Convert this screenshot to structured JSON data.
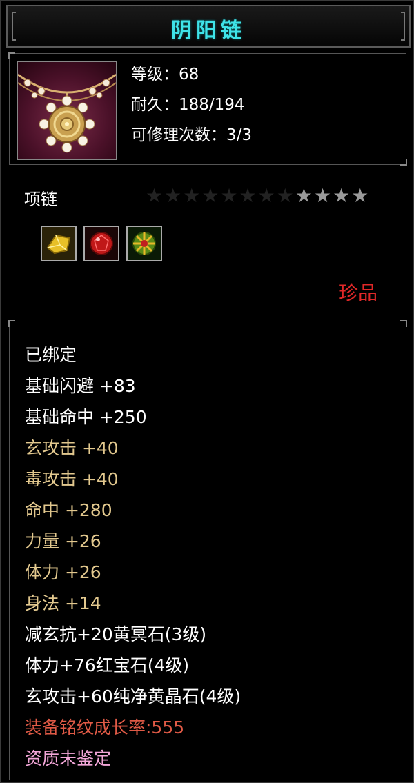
{
  "item": {
    "name": "阴阳链",
    "level_line": "等级：68",
    "durability_line": "耐久：188/194",
    "repair_line": "可修理次数：3/3",
    "type": "项链",
    "rarity": "珍品",
    "stars_total": 12,
    "stars_lit": 4
  },
  "icons": {
    "item_icon": "necklace-icon",
    "gems": [
      "yellow-gem-icon",
      "red-gem-icon",
      "green-gold-gem-icon"
    ]
  },
  "colors": {
    "title": "#3fe3e8",
    "base_stat": "#ffffff",
    "bonus_stat": "#e2c88e",
    "rarity": "#e02828",
    "growth": "#e05a46",
    "quality": "#f3a6d8"
  },
  "attributes": [
    {
      "text": "已绑定",
      "kind": "white"
    },
    {
      "text": "基础闪避  +83",
      "kind": "white"
    },
    {
      "text": "基础命中  +250",
      "kind": "white"
    },
    {
      "text": "玄攻击  +40",
      "kind": "gold"
    },
    {
      "text": "毒攻击  +40",
      "kind": "gold"
    },
    {
      "text": "命中  +280",
      "kind": "gold"
    },
    {
      "text": "力量  +26",
      "kind": "gold"
    },
    {
      "text": "体力  +26",
      "kind": "gold"
    },
    {
      "text": "身法  +14",
      "kind": "gold"
    },
    {
      "text": "减玄抗+20黄冥石(3级)",
      "kind": "white"
    },
    {
      "text": "体力+76红宝石(4级)",
      "kind": "white"
    },
    {
      "text": "玄攻击+60纯净黄晶石(4级)",
      "kind": "white"
    },
    {
      "text": "装备铭纹成长率:555",
      "kind": "red"
    },
    {
      "text": "资质未鉴定",
      "kind": "pink"
    }
  ]
}
